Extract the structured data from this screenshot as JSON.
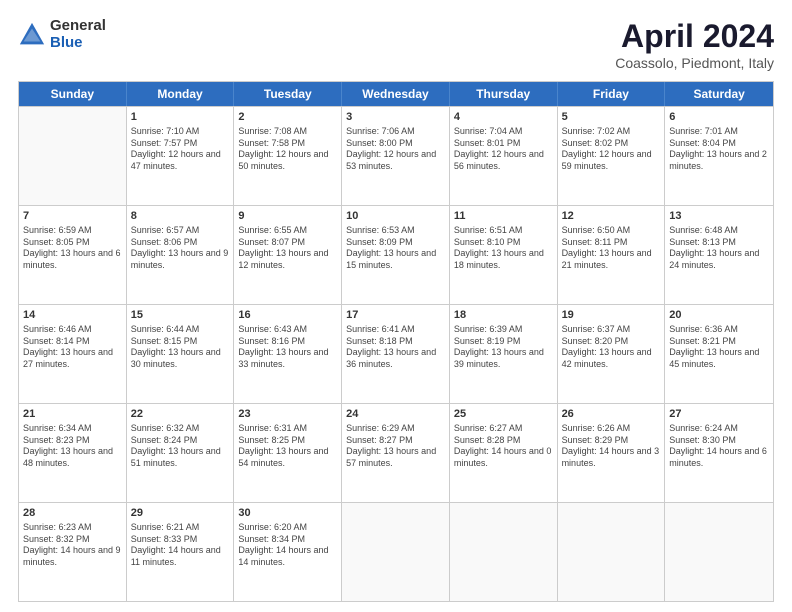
{
  "logo": {
    "general": "General",
    "blue": "Blue"
  },
  "title": {
    "month": "April 2024",
    "location": "Coassolo, Piedmont, Italy"
  },
  "weekdays": [
    "Sunday",
    "Monday",
    "Tuesday",
    "Wednesday",
    "Thursday",
    "Friday",
    "Saturday"
  ],
  "weeks": [
    [
      {
        "day": "",
        "empty": true
      },
      {
        "day": "1",
        "sunrise": "Sunrise: 7:10 AM",
        "sunset": "Sunset: 7:57 PM",
        "daylight": "Daylight: 12 hours and 47 minutes."
      },
      {
        "day": "2",
        "sunrise": "Sunrise: 7:08 AM",
        "sunset": "Sunset: 7:58 PM",
        "daylight": "Daylight: 12 hours and 50 minutes."
      },
      {
        "day": "3",
        "sunrise": "Sunrise: 7:06 AM",
        "sunset": "Sunset: 8:00 PM",
        "daylight": "Daylight: 12 hours and 53 minutes."
      },
      {
        "day": "4",
        "sunrise": "Sunrise: 7:04 AM",
        "sunset": "Sunset: 8:01 PM",
        "daylight": "Daylight: 12 hours and 56 minutes."
      },
      {
        "day": "5",
        "sunrise": "Sunrise: 7:02 AM",
        "sunset": "Sunset: 8:02 PM",
        "daylight": "Daylight: 12 hours and 59 minutes."
      },
      {
        "day": "6",
        "sunrise": "Sunrise: 7:01 AM",
        "sunset": "Sunset: 8:04 PM",
        "daylight": "Daylight: 13 hours and 2 minutes."
      }
    ],
    [
      {
        "day": "7",
        "sunrise": "Sunrise: 6:59 AM",
        "sunset": "Sunset: 8:05 PM",
        "daylight": "Daylight: 13 hours and 6 minutes."
      },
      {
        "day": "8",
        "sunrise": "Sunrise: 6:57 AM",
        "sunset": "Sunset: 8:06 PM",
        "daylight": "Daylight: 13 hours and 9 minutes."
      },
      {
        "day": "9",
        "sunrise": "Sunrise: 6:55 AM",
        "sunset": "Sunset: 8:07 PM",
        "daylight": "Daylight: 13 hours and 12 minutes."
      },
      {
        "day": "10",
        "sunrise": "Sunrise: 6:53 AM",
        "sunset": "Sunset: 8:09 PM",
        "daylight": "Daylight: 13 hours and 15 minutes."
      },
      {
        "day": "11",
        "sunrise": "Sunrise: 6:51 AM",
        "sunset": "Sunset: 8:10 PM",
        "daylight": "Daylight: 13 hours and 18 minutes."
      },
      {
        "day": "12",
        "sunrise": "Sunrise: 6:50 AM",
        "sunset": "Sunset: 8:11 PM",
        "daylight": "Daylight: 13 hours and 21 minutes."
      },
      {
        "day": "13",
        "sunrise": "Sunrise: 6:48 AM",
        "sunset": "Sunset: 8:13 PM",
        "daylight": "Daylight: 13 hours and 24 minutes."
      }
    ],
    [
      {
        "day": "14",
        "sunrise": "Sunrise: 6:46 AM",
        "sunset": "Sunset: 8:14 PM",
        "daylight": "Daylight: 13 hours and 27 minutes."
      },
      {
        "day": "15",
        "sunrise": "Sunrise: 6:44 AM",
        "sunset": "Sunset: 8:15 PM",
        "daylight": "Daylight: 13 hours and 30 minutes."
      },
      {
        "day": "16",
        "sunrise": "Sunrise: 6:43 AM",
        "sunset": "Sunset: 8:16 PM",
        "daylight": "Daylight: 13 hours and 33 minutes."
      },
      {
        "day": "17",
        "sunrise": "Sunrise: 6:41 AM",
        "sunset": "Sunset: 8:18 PM",
        "daylight": "Daylight: 13 hours and 36 minutes."
      },
      {
        "day": "18",
        "sunrise": "Sunrise: 6:39 AM",
        "sunset": "Sunset: 8:19 PM",
        "daylight": "Daylight: 13 hours and 39 minutes."
      },
      {
        "day": "19",
        "sunrise": "Sunrise: 6:37 AM",
        "sunset": "Sunset: 8:20 PM",
        "daylight": "Daylight: 13 hours and 42 minutes."
      },
      {
        "day": "20",
        "sunrise": "Sunrise: 6:36 AM",
        "sunset": "Sunset: 8:21 PM",
        "daylight": "Daylight: 13 hours and 45 minutes."
      }
    ],
    [
      {
        "day": "21",
        "sunrise": "Sunrise: 6:34 AM",
        "sunset": "Sunset: 8:23 PM",
        "daylight": "Daylight: 13 hours and 48 minutes."
      },
      {
        "day": "22",
        "sunrise": "Sunrise: 6:32 AM",
        "sunset": "Sunset: 8:24 PM",
        "daylight": "Daylight: 13 hours and 51 minutes."
      },
      {
        "day": "23",
        "sunrise": "Sunrise: 6:31 AM",
        "sunset": "Sunset: 8:25 PM",
        "daylight": "Daylight: 13 hours and 54 minutes."
      },
      {
        "day": "24",
        "sunrise": "Sunrise: 6:29 AM",
        "sunset": "Sunset: 8:27 PM",
        "daylight": "Daylight: 13 hours and 57 minutes."
      },
      {
        "day": "25",
        "sunrise": "Sunrise: 6:27 AM",
        "sunset": "Sunset: 8:28 PM",
        "daylight": "Daylight: 14 hours and 0 minutes."
      },
      {
        "day": "26",
        "sunrise": "Sunrise: 6:26 AM",
        "sunset": "Sunset: 8:29 PM",
        "daylight": "Daylight: 14 hours and 3 minutes."
      },
      {
        "day": "27",
        "sunrise": "Sunrise: 6:24 AM",
        "sunset": "Sunset: 8:30 PM",
        "daylight": "Daylight: 14 hours and 6 minutes."
      }
    ],
    [
      {
        "day": "28",
        "sunrise": "Sunrise: 6:23 AM",
        "sunset": "Sunset: 8:32 PM",
        "daylight": "Daylight: 14 hours and 9 minutes."
      },
      {
        "day": "29",
        "sunrise": "Sunrise: 6:21 AM",
        "sunset": "Sunset: 8:33 PM",
        "daylight": "Daylight: 14 hours and 11 minutes."
      },
      {
        "day": "30",
        "sunrise": "Sunrise: 6:20 AM",
        "sunset": "Sunset: 8:34 PM",
        "daylight": "Daylight: 14 hours and 14 minutes."
      },
      {
        "day": "",
        "empty": true
      },
      {
        "day": "",
        "empty": true
      },
      {
        "day": "",
        "empty": true
      },
      {
        "day": "",
        "empty": true
      }
    ]
  ]
}
